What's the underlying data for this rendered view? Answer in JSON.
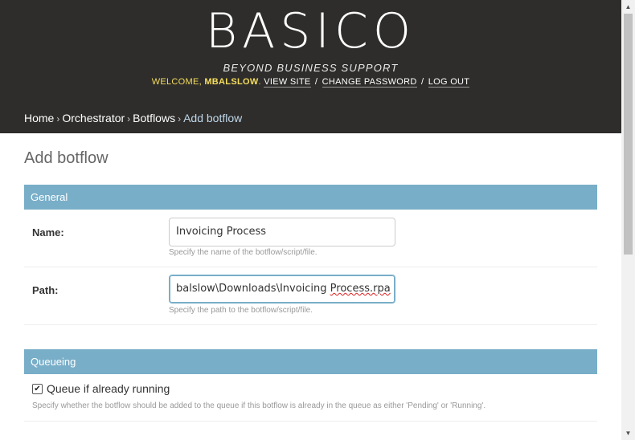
{
  "header": {
    "logo": "BASICO",
    "tagline": "BEYOND BUSINESS SUPPORT",
    "welcome": "WELCOME,",
    "username": "MBALSLOW",
    "links": [
      "VIEW SITE",
      "CHANGE PASSWORD",
      "LOG OUT"
    ],
    "separator": "/"
  },
  "breadcrumbs": {
    "items": [
      "Home",
      "Orchestrator",
      "Botflows"
    ],
    "current": "Add botflow",
    "arrow": "›"
  },
  "page": {
    "title": "Add botflow"
  },
  "general": {
    "caption": "General",
    "name": {
      "label": "Name:",
      "value": "Invoicing Process",
      "help": "Specify the name of the botflow/script/file."
    },
    "path": {
      "label": "Path:",
      "value_prefix": "balslow\\Downloads\\Invoicing ",
      "value_misspelled": "Process.rpa",
      "help": "Specify the path to the botflow/script/file."
    }
  },
  "queueing": {
    "caption": "Queueing",
    "checkbox_label": "Queue if already running",
    "checked": true,
    "check_mark": "✔",
    "help": "Specify whether the botflow should be added to the queue if this botflow is already in the queue as either 'Pending' or 'Running'."
  },
  "scrollbar": {
    "up_arrow": "▲",
    "down_arrow": "▼"
  },
  "colors": {
    "header_bg": "#2e2d2b",
    "module_caption_bg": "#79aec8",
    "welcome_text": "#f5dd5d",
    "breadcrumb_current": "#bfd7ea"
  }
}
